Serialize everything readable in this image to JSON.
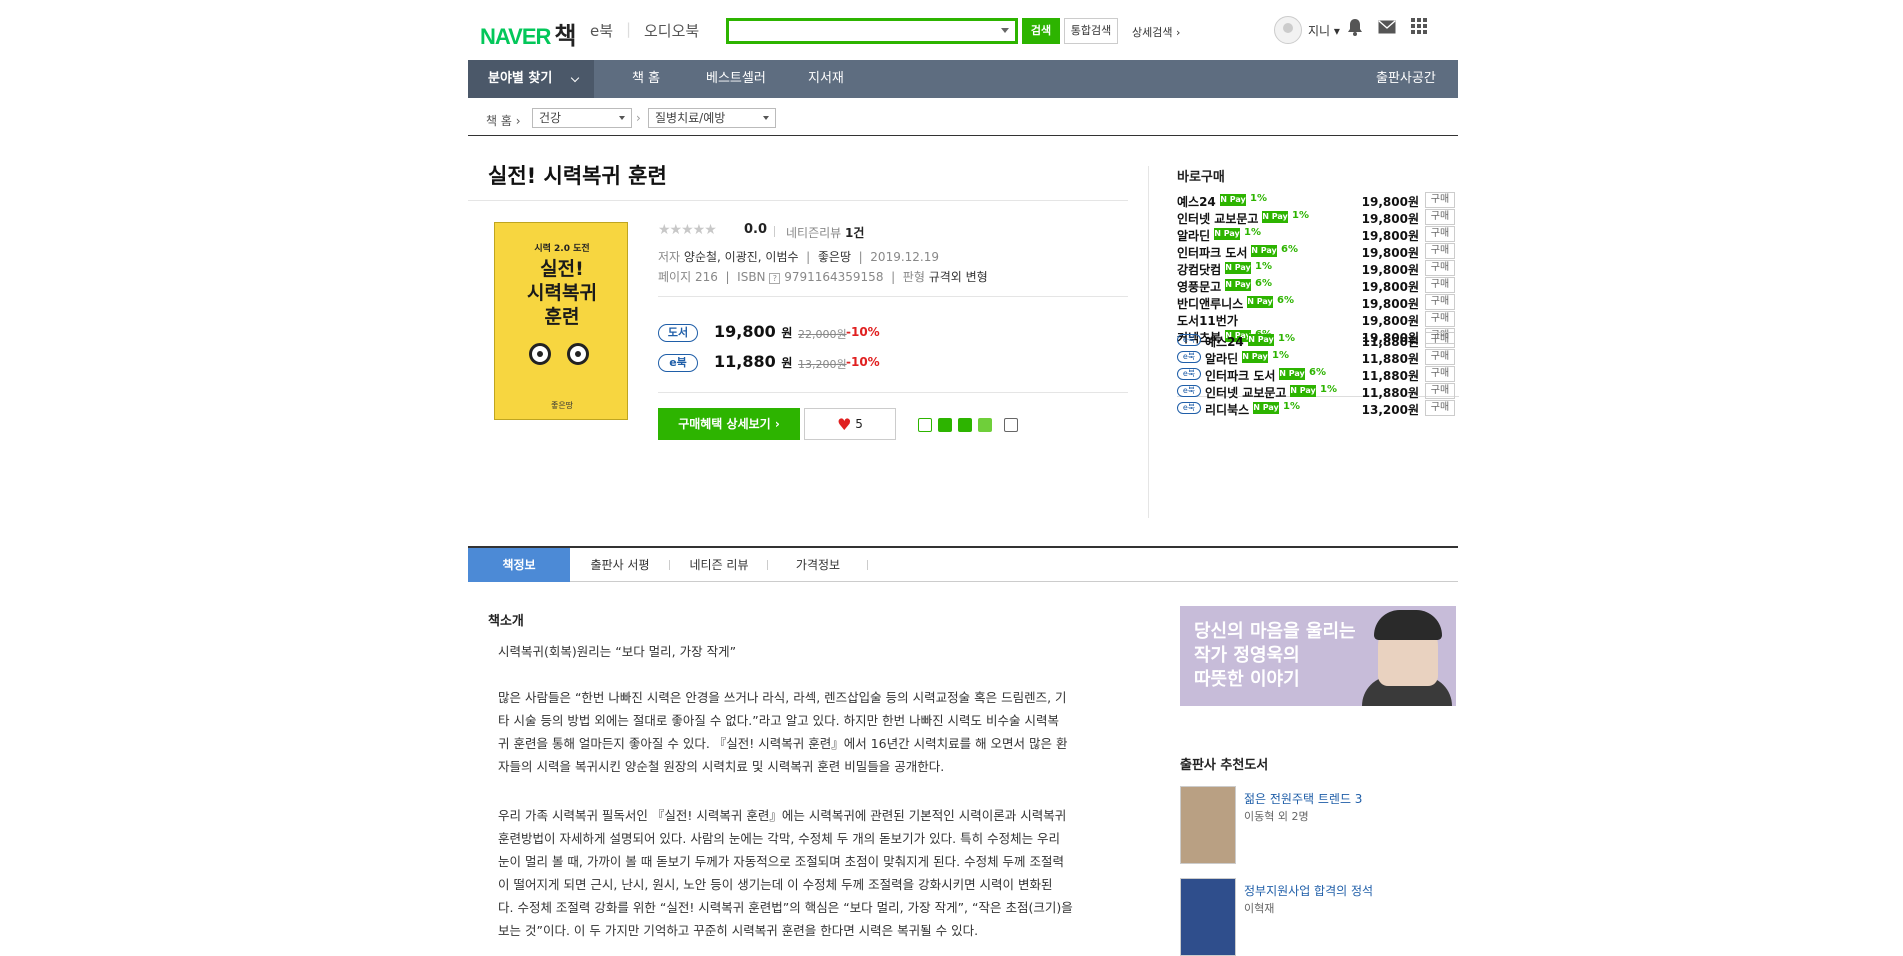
{
  "header": {
    "logo_naver": "NAVER",
    "logo_book": "책",
    "nav_ebook": "e북",
    "nav_audiobook": "오디오북",
    "search_placeholder": "",
    "search_button": "검색",
    "integrated_search": "통합검색",
    "advanced_search": "상세검색 ›",
    "user_name": "지니 ▾"
  },
  "gnb": {
    "category": "분야별 찾기",
    "items": [
      "책 홈",
      "베스트셀러",
      "지서재"
    ],
    "publisher": "출판사공간"
  },
  "breadcrumb": {
    "home": "책 홈 ›",
    "cat1": "건강",
    "cat2": "질병치료/예방"
  },
  "book": {
    "title": "실전! 시력복귀 훈련",
    "cover_top": "시력 2.0 도전",
    "cover_title": "실전!\n시력복귀\n훈련",
    "cover_pub": "좋은땅",
    "stars": "★★★★★",
    "rating": "0.0",
    "review_label": "네티즌리뷰",
    "review_count": "1건",
    "author_label": "저자",
    "authors": "양순철, 이광진, 이범수",
    "publisher": "좋은땅",
    "date": "2019.12.19",
    "page_label": "페이지",
    "pages": "216",
    "isbn_label": "ISBN",
    "isbn": "9791164359158",
    "format_label": "판형",
    "format": "규격외 변형"
  },
  "prices": {
    "paper_tag": "도서",
    "paper_price": "19,800",
    "paper_orig": "22,000원",
    "paper_disc": "-10%",
    "ebook_tag": "e북",
    "ebook_price": "11,880",
    "ebook_orig": "13,200원",
    "ebook_disc": "-10%",
    "won": "원"
  },
  "actions": {
    "buy_detail": "구매혜택 상세보기 ›",
    "likes": "5"
  },
  "buy_panel": {
    "title": "바로구매",
    "npay": "N Pay",
    "buy": "구매",
    "ebook_tag": "e북",
    "paper": [
      {
        "store": "예스24",
        "pct": "1%",
        "price": "19,800원"
      },
      {
        "store": "인터넷 교보문고",
        "pct": "1%",
        "price": "19,800원"
      },
      {
        "store": "알라딘",
        "pct": "1%",
        "price": "19,800원"
      },
      {
        "store": "인터파크 도서",
        "pct": "6%",
        "price": "19,800원"
      },
      {
        "store": "강컴닷컴",
        "pct": "1%",
        "price": "19,800원"
      },
      {
        "store": "영풍문고",
        "pct": "6%",
        "price": "19,800원"
      },
      {
        "store": "반디앤루니스",
        "pct": "6%",
        "price": "19,800원"
      },
      {
        "store": "도서11번가",
        "pct": "",
        "price": "19,800원"
      },
      {
        "store": "커넥츠북",
        "pct": "6%",
        "price": "19,800원"
      }
    ],
    "ebook": [
      {
        "store": "예스24",
        "pct": "1%",
        "price": "11,880원"
      },
      {
        "store": "알라딘",
        "pct": "1%",
        "price": "11,880원"
      },
      {
        "store": "인터파크 도서",
        "pct": "6%",
        "price": "11,880원"
      },
      {
        "store": "인터넷 교보문고",
        "pct": "1%",
        "price": "11,880원"
      },
      {
        "store": "리디북스",
        "pct": "1%",
        "price": "13,200원"
      }
    ]
  },
  "tabs": [
    "책정보",
    "출판사 서평",
    "네티즌 리뷰",
    "가격정보"
  ],
  "intro": {
    "heading": "책소개",
    "p1": "시력복귀(회복)원리는 “보다 멀리, 가장 작게”",
    "p2": [
      "많은 사람들은 “한번 나빠진 시력은 안경을 쓰거나 라식, 라섹, 렌즈삽입술 등의 시력교정술 혹은 드림렌즈, 기",
      "타 시술 등의 방법 외에는 절대로 좋아질 수 없다.”라고 알고 있다. 하지만 한번 나빠진 시력도 비수술 시력복",
      "귀 훈련을 통해 얼마든지 좋아질 수 있다. 『실전! 시력복귀 훈련』에서 16년간 시력치료를 해 오면서 많은 환",
      "자들의 시력을 복귀시킨 양순철 원장의 시력치료 및 시력복귀 훈련 비밀들을 공개한다."
    ],
    "p3": [
      "우리 가족 시력복귀 필독서인 『실전! 시력복귀 훈련』에는 시력복귀에 관련된 기본적인 시력이론과 시력복귀",
      "훈련방법이 자세하게 설명되어 있다. 사람의 눈에는 각막, 수정체 두 개의 돋보기가 있다. 특히 수정체는 우리",
      "눈이 멀리 볼 때, 가까이 볼 때 돋보기 두께가 자동적으로 조절되며 초점이 맞춰지게 된다. 수정체 두께 조절력",
      "이 떨어지게 되면 근시, 난시, 원시, 노안 등이 생기는데 이 수정체 두께 조절력을 강화시키면 시력이 변화된",
      "다. 수정체 조절력 강화를 위한 “실전! 시력복귀 훈련법”의 핵심은 “보다 멀리, 가장 작게”, “작은 초점(크기)을",
      "보는 것”이다. 이 두 가지만 기억하고 꾸준히 시력복귀 훈련을 한다면 시력은 복귀될 수 있다."
    ]
  },
  "ad": {
    "text": "당신의 마음을 울리는\n작가 정영욱의\n따뜻한 이야기"
  },
  "recommend": {
    "heading": "출판사 추천도서",
    "items": [
      {
        "title": "젊은 전원주택 트렌드 3",
        "author": "이동혁 외 2명"
      },
      {
        "title": "정부지원사업 합격의 정석",
        "author": "이혁재"
      }
    ]
  }
}
